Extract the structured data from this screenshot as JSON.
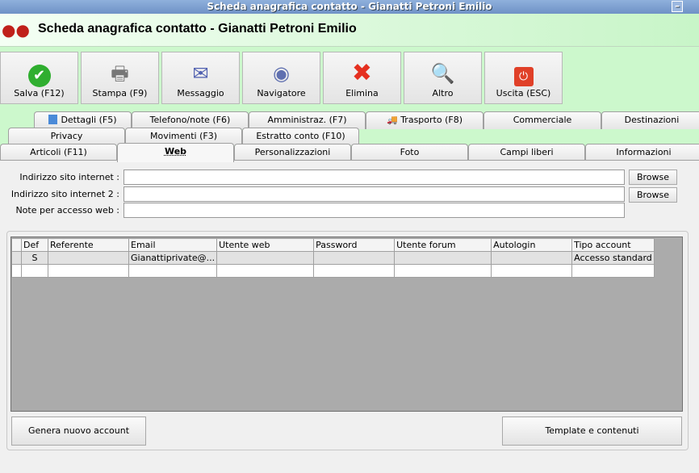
{
  "window": {
    "title": "Scheda anagrafica contatto - Gianatti Petroni Emilio"
  },
  "header": {
    "title": "Scheda anagrafica contatto - Gianatti Petroni Emilio"
  },
  "toolbar": [
    {
      "label": "Salva (F12)",
      "icon": "check-icon"
    },
    {
      "label": "Stampa (F9)",
      "icon": "printer-icon"
    },
    {
      "label": "Messaggio",
      "icon": "message-icon"
    },
    {
      "label": "Navigatore",
      "icon": "compass-icon"
    },
    {
      "label": "Elimina",
      "icon": "delete-icon"
    },
    {
      "label": "Altro",
      "icon": "search-book-icon"
    },
    {
      "label": "Uscita (ESC)",
      "icon": "power-icon"
    }
  ],
  "tabs": {
    "row1": [
      "Dettagli (F5)",
      "Telefono/note (F6)",
      "Amministraz. (F7)",
      "Trasporto (F8)",
      "Commerciale",
      "Destinazioni"
    ],
    "row2": [
      "Privacy",
      "Movimenti (F3)",
      "Estratto conto (F10)"
    ],
    "row3": [
      "Articoli (F11)",
      "Web",
      "Personalizzazioni",
      "Foto",
      "Campi liberi",
      "Informazioni"
    ],
    "active": "Web"
  },
  "form": {
    "site1_label": "Indirizzo sito internet :",
    "site1_value": "",
    "site2_label": "Indirizzo sito internet 2 :",
    "site2_value": "",
    "notes_label": "Note per accesso web :",
    "notes_value": "",
    "browse1": "Browse",
    "browse2": "Browse"
  },
  "grid": {
    "columns": [
      "Def",
      "Referente",
      "Email",
      "Utente web",
      "Password",
      "Utente forum",
      "Autologin",
      "Tipo account"
    ],
    "rows": [
      [
        "S",
        "",
        "Gianattiprivate@...",
        "",
        "",
        "",
        "",
        "Accesso standard"
      ],
      [
        "",
        "",
        "",
        "",
        "",
        "",
        "",
        ""
      ]
    ]
  },
  "buttons": {
    "generate": "Genera nuovo account",
    "template": "Template e contenuti"
  }
}
